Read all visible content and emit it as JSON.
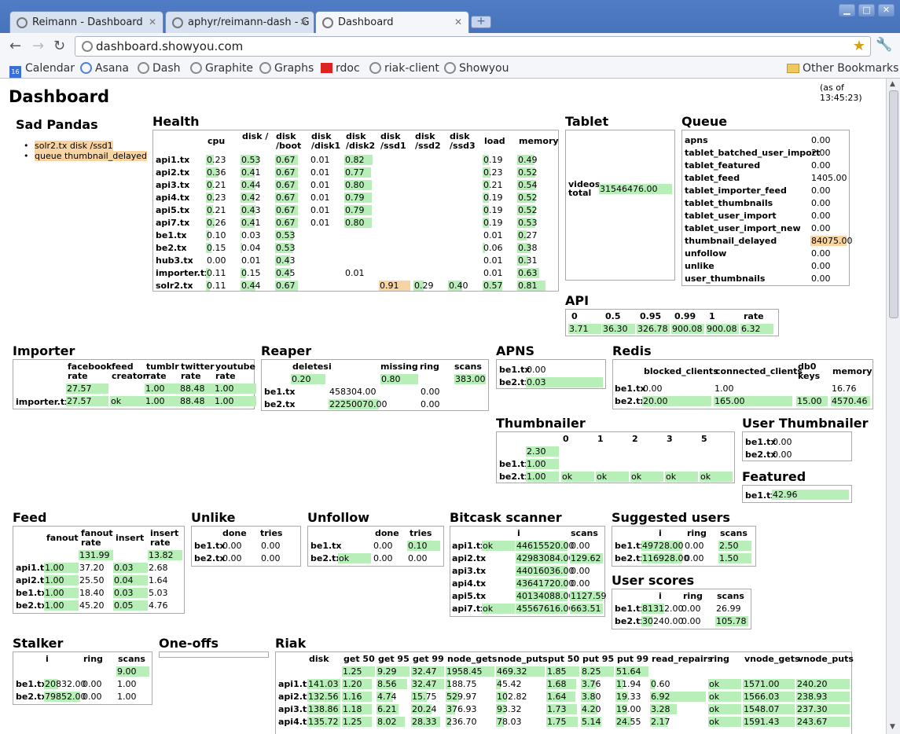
{
  "browser": {
    "tabs": [
      {
        "label": "Reimann - Dashboard"
      },
      {
        "label": "aphyr/reimann-dash - G"
      },
      {
        "label": "Dashboard"
      }
    ],
    "new_tab": "+",
    "url": "dashboard.showyou.com",
    "bookmarks": [
      {
        "label": "Calendar",
        "icon": "calendar-icon"
      },
      {
        "label": "Asana",
        "icon": "asana-icon"
      },
      {
        "label": "Dash",
        "icon": "globe-icon"
      },
      {
        "label": "Graphite",
        "icon": "globe-icon"
      },
      {
        "label": "Graphs",
        "icon": "globe-icon"
      },
      {
        "label": "rdoc",
        "icon": "rdoc-icon"
      },
      {
        "label": "riak-client",
        "icon": "globe-icon"
      },
      {
        "label": "Showyou",
        "icon": "globe-icon"
      }
    ],
    "other_bookmarks": "Other Bookmarks"
  },
  "dashboard": {
    "title": "Dashboard",
    "as_of": "(as of 13:45:23)"
  },
  "sad_pandas": {
    "title": "Sad Pandas",
    "items": [
      "solr2.tx disk /ssd1",
      "queue thumbnail_delayed"
    ]
  },
  "health": {
    "title": "Health",
    "columns": [
      "cpu",
      "disk /",
      "disk /boot",
      "disk /disk1",
      "disk /disk2",
      "disk /ssd1",
      "disk /ssd2",
      "disk /ssd3",
      "load",
      "memory"
    ],
    "rows": [
      {
        "host": "api1.tx",
        "v": [
          "0.23",
          "0.53",
          "0.67",
          "0.01",
          "0.82",
          "",
          "",
          "",
          "0.19",
          "0.49"
        ]
      },
      {
        "host": "api2.tx",
        "v": [
          "0.36",
          "0.41",
          "0.67",
          "0.01",
          "0.77",
          "",
          "",
          "",
          "0.23",
          "0.52"
        ]
      },
      {
        "host": "api3.tx",
        "v": [
          "0.21",
          "0.44",
          "0.67",
          "0.01",
          "0.80",
          "",
          "",
          "",
          "0.21",
          "0.54"
        ]
      },
      {
        "host": "api4.tx",
        "v": [
          "0.23",
          "0.42",
          "0.67",
          "0.01",
          "0.79",
          "",
          "",
          "",
          "0.19",
          "0.52"
        ]
      },
      {
        "host": "api5.tx",
        "v": [
          "0.21",
          "0.43",
          "0.67",
          "0.01",
          "0.79",
          "",
          "",
          "",
          "0.19",
          "0.52"
        ]
      },
      {
        "host": "api7.tx",
        "v": [
          "0.26",
          "0.41",
          "0.67",
          "0.01",
          "0.80",
          "",
          "",
          "",
          "0.19",
          "0.53"
        ]
      },
      {
        "host": "be1.tx",
        "v": [
          "0.10",
          "0.03",
          "0.53",
          "",
          "",
          "",
          "",
          "",
          "0.01",
          "0.27"
        ]
      },
      {
        "host": "be2.tx",
        "v": [
          "0.15",
          "0.04",
          "0.53",
          "",
          "",
          "",
          "",
          "",
          "0.06",
          "0.38"
        ]
      },
      {
        "host": "hub3.tx",
        "v": [
          "0.00",
          "0.01",
          "0.43",
          "",
          "",
          "",
          "",
          "",
          "0.01",
          "0.31"
        ]
      },
      {
        "host": "importer.tx",
        "v": [
          "0.11",
          "0.15",
          "0.45",
          "",
          "0.01",
          "",
          "",
          "",
          "0.01",
          "0.63"
        ]
      },
      {
        "host": "solr2.tx",
        "v": [
          "0.11",
          "0.44",
          "0.67",
          "",
          "",
          "0.91",
          "0.29",
          "0.40",
          "0.57",
          "0.81"
        ]
      }
    ]
  },
  "tablet": {
    "title": "Tablet",
    "label": "videos total",
    "value": "31546476.00"
  },
  "queue": {
    "title": "Queue",
    "rows": [
      {
        "name": "apns",
        "value": "0.00"
      },
      {
        "name": "tablet_batched_user_import",
        "value": "2.00"
      },
      {
        "name": "tablet_featured",
        "value": "0.00"
      },
      {
        "name": "tablet_feed",
        "value": "1405.00"
      },
      {
        "name": "tablet_importer_feed",
        "value": "0.00"
      },
      {
        "name": "tablet_thumbnails",
        "value": "0.00"
      },
      {
        "name": "tablet_user_import",
        "value": "0.00"
      },
      {
        "name": "tablet_user_import_new",
        "value": "0.00"
      },
      {
        "name": "thumbnail_delayed",
        "value": "84075.00"
      },
      {
        "name": "unfollow",
        "value": "0.00"
      },
      {
        "name": "unlike",
        "value": "0.00"
      },
      {
        "name": "user_thumbnails",
        "value": "0.00"
      }
    ]
  },
  "api": {
    "title": "API",
    "columns": [
      "0",
      "0.5",
      "0.95",
      "0.99",
      "1",
      "rate"
    ],
    "values": [
      "3.71",
      "36.30",
      "326.78",
      "900.08",
      "900.08",
      "6.32"
    ]
  },
  "importer": {
    "title": "Importer",
    "columns": [
      "facebook rate",
      "feed creator",
      "tumblr rate",
      "twitter rate",
      "youtube rate"
    ],
    "total": [
      "27.57",
      "",
      "1.00",
      "88.48",
      "1.00"
    ],
    "host": "importer.tx",
    "row": [
      "27.57",
      "ok",
      "1.00",
      "88.48",
      "1.00"
    ]
  },
  "reaper": {
    "title": "Reaper",
    "columns": [
      "deletes",
      "i",
      "missing",
      "ring",
      "scans"
    ],
    "top": [
      "0.20",
      "",
      "0.80",
      "",
      "383.00"
    ],
    "rows": [
      {
        "host": "be1.tx",
        "i": "458304.00",
        "ring": "0.00"
      },
      {
        "host": "be2.tx",
        "i": "22250070.00",
        "ring": "0.00"
      }
    ]
  },
  "apns": {
    "title": "APNS",
    "rows": [
      {
        "host": "be1.tx",
        "value": "0.00"
      },
      {
        "host": "be2.tx",
        "value": "0.03"
      }
    ]
  },
  "redis": {
    "title": "Redis",
    "columns": [
      "blocked_clients",
      "connected_clients",
      "db0 keys",
      "memory"
    ],
    "rows": [
      {
        "host": "be1.tx",
        "v": [
          "0.00",
          "1.00",
          "",
          "16.76"
        ]
      },
      {
        "host": "be2.tx",
        "v": [
          "20.00",
          "165.00",
          "15.00",
          "4570.46"
        ]
      }
    ]
  },
  "thumbnailer": {
    "title": "Thumbnailer",
    "columns": [
      "0",
      "1",
      "2",
      "3",
      "5"
    ],
    "top": "2.30",
    "rows": [
      {
        "host": "be1.tx",
        "v": "1.00",
        "cols": [
          "",
          "",
          "",
          "",
          ""
        ]
      },
      {
        "host": "be2.tx",
        "v": "1.00",
        "cols": [
          "ok",
          "ok",
          "ok",
          "ok",
          "ok"
        ]
      }
    ]
  },
  "user_thumbnailer": {
    "title": "User Thumbnailer",
    "rows": [
      {
        "host": "be1.tx",
        "value": "0.00"
      },
      {
        "host": "be2.tx",
        "value": "0.00"
      }
    ]
  },
  "featured": {
    "title": "Featured",
    "rows": [
      {
        "host": "be1.tx",
        "value": "42.96"
      }
    ]
  },
  "feed": {
    "title": "Feed",
    "columns": [
      "fanout",
      "fanout rate",
      "insert",
      "insert rate"
    ],
    "top": [
      "",
      "131.99",
      "",
      "13.82"
    ],
    "rows": [
      {
        "host": "api1.tx",
        "v": [
          "1.00",
          "37.20",
          "0.03",
          "2.68"
        ]
      },
      {
        "host": "api2.tx",
        "v": [
          "1.00",
          "25.50",
          "0.04",
          "1.64"
        ]
      },
      {
        "host": "be1.tx",
        "v": [
          "1.00",
          "18.40",
          "0.03",
          "5.03"
        ]
      },
      {
        "host": "be2.tx",
        "v": [
          "1.00",
          "45.20",
          "0.05",
          "4.76"
        ]
      }
    ]
  },
  "unlike": {
    "title": "Unlike",
    "columns": [
      "done",
      "tries"
    ],
    "rows": [
      {
        "host": "be1.tx",
        "v": [
          "0.00",
          "0.00"
        ]
      },
      {
        "host": "be2.tx",
        "v": [
          "0.00",
          "0.00"
        ]
      }
    ]
  },
  "unfollow": {
    "title": "Unfollow",
    "columns": [
      "done",
      "tries"
    ],
    "rows": [
      {
        "host": "be1.tx",
        "pre": "",
        "v": [
          "0.00",
          "0.10"
        ]
      },
      {
        "host": "be2.tx",
        "pre": "ok",
        "v": [
          "0.00",
          "0.00"
        ]
      }
    ]
  },
  "bitcask": {
    "title": "Bitcask scanner",
    "columns": [
      "i",
      "scans"
    ],
    "rows": [
      {
        "host": "api1.tx",
        "pre": "ok",
        "v": [
          "44615520.00",
          "0.00"
        ]
      },
      {
        "host": "api2.tx",
        "pre": "",
        "v": [
          "42983084.00",
          "129.62"
        ]
      },
      {
        "host": "api3.tx",
        "pre": "",
        "v": [
          "44016036.00",
          "0.00"
        ]
      },
      {
        "host": "api4.tx",
        "pre": "",
        "v": [
          "43641720.00",
          "0.00"
        ]
      },
      {
        "host": "api5.tx",
        "pre": "",
        "v": [
          "40134088.00",
          "1127.59"
        ]
      },
      {
        "host": "api7.tx",
        "pre": "ok",
        "v": [
          "45567616.00",
          "663.51"
        ]
      }
    ]
  },
  "suggested": {
    "title": "Suggested users",
    "columns": [
      "i",
      "ring",
      "scans"
    ],
    "rows": [
      {
        "host": "be1.tx",
        "v": [
          "49728.00",
          "0.00",
          "2.50"
        ]
      },
      {
        "host": "be2.tx",
        "v": [
          "116928.00",
          "0.00",
          "1.50"
        ]
      }
    ]
  },
  "user_scores": {
    "title": "User scores",
    "columns": [
      "i",
      "ring",
      "scans"
    ],
    "rows": [
      {
        "host": "be1.tx",
        "v": [
          "81312.00",
          "0.00",
          "26.99"
        ]
      },
      {
        "host": "be2.tx",
        "v": [
          "30240.00",
          "0.00",
          "105.78"
        ]
      }
    ]
  },
  "stalker": {
    "title": "Stalker",
    "columns": [
      "i",
      "ring",
      "scans"
    ],
    "top": "9.00",
    "rows": [
      {
        "host": "be1.tx",
        "v": [
          "20832.00",
          "0.00",
          "1.00"
        ]
      },
      {
        "host": "be2.tx",
        "v": [
          "79852.00",
          "0.00",
          "1.00"
        ]
      }
    ]
  },
  "oneoffs": {
    "title": "One-offs"
  },
  "riak": {
    "title": "Riak",
    "columns": [
      "disk",
      "get 50",
      "get 95",
      "get 99",
      "node_gets",
      "node_puts",
      "put 50",
      "put 95",
      "put 99",
      "read_repairs",
      "ring",
      "vnode_gets",
      "vnode_puts"
    ],
    "top": [
      "",
      "1.25",
      "9.29",
      "32.47",
      "1958.45",
      "469.32",
      "1.85",
      "8.25",
      "51.64",
      "",
      "",
      "",
      ""
    ],
    "rows": [
      {
        "host": "api1.tx",
        "v": [
          "141.03",
          "1.20",
          "8.56",
          "32.47",
          "188.75",
          "45.42",
          "1.68",
          "3.76",
          "11.94",
          "0.60",
          "ok",
          "1571.00",
          "240.20"
        ]
      },
      {
        "host": "api2.tx",
        "v": [
          "132.56",
          "1.16",
          "4.74",
          "15.75",
          "529.97",
          "102.82",
          "1.64",
          "3.80",
          "19.33",
          "6.92",
          "ok",
          "1566.03",
          "238.93"
        ]
      },
      {
        "host": "api3.tx",
        "v": [
          "138.86",
          "1.18",
          "6.21",
          "20.24",
          "376.93",
          "93.32",
          "1.73",
          "4.20",
          "19.00",
          "3.28",
          "ok",
          "1548.07",
          "237.30"
        ]
      },
      {
        "host": "api4.tx",
        "v": [
          "135.72",
          "1.25",
          "8.02",
          "28.33",
          "236.70",
          "78.03",
          "1.75",
          "5.14",
          "24.55",
          "2.17",
          "ok",
          "1591.43",
          "243.67"
        ]
      }
    ]
  }
}
